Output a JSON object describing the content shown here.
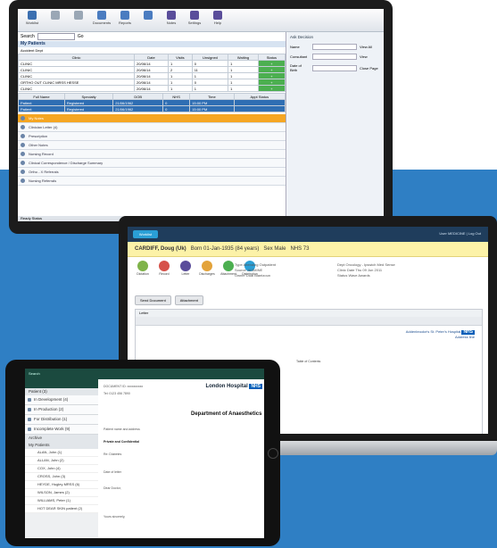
{
  "desktop": {
    "toolbar": [
      {
        "label": "Worklist",
        "color": "#3b6fb0",
        "icon": "list-icon"
      },
      {
        "label": "",
        "color": "#9aa7b5",
        "icon": "blank-icon"
      },
      {
        "label": "",
        "color": "#9aa7b5",
        "icon": "blank-icon"
      },
      {
        "label": "Documents",
        "color": "#4a7cc0",
        "icon": "document-icon"
      },
      {
        "label": "Reports",
        "color": "#4a7cc0",
        "icon": "report-icon"
      },
      {
        "label": "",
        "color": "#4a7cc0",
        "icon": "settings-icon"
      },
      {
        "label": "Notes",
        "color": "#5a4d9a",
        "icon": "notes-icon"
      },
      {
        "label": "Settings",
        "color": "#5a4d9a",
        "icon": "gear-icon"
      },
      {
        "label": "Help",
        "color": "#5a4d9a",
        "icon": "help-icon"
      }
    ],
    "search_label": "Search",
    "search_go": "Go",
    "section_title": "My Patients",
    "filter_label": "Accident Dept",
    "grid_headers": [
      "Clinic",
      "Date",
      "Visits",
      "Unsigned",
      "Waiting",
      "Status"
    ],
    "grid_rows": [
      [
        "CLINIC",
        "20/06/14",
        "1",
        "0",
        "1",
        "+"
      ],
      [
        "CLINIC",
        "20/06/14",
        "2",
        "11",
        "1",
        "+"
      ],
      [
        "CLINIC",
        "20/06/14",
        "1",
        "1",
        "1",
        "+"
      ],
      [
        "ORTHO OUT CLINIC MRSS HESSE",
        "20/06/14",
        "1",
        "0",
        "1",
        "+"
      ],
      [
        "CLINIC",
        "20/06/14",
        "1",
        "1",
        "1",
        "+"
      ]
    ],
    "sub_headers": [
      "Full Name",
      "Specialty",
      "DOB",
      "NHS",
      "Time",
      "Appt Status"
    ],
    "sub_rows": [
      [
        "Patient",
        "Registered",
        "21/06/1962",
        "0",
        "15:00 PM"
      ],
      [
        "Patient",
        "Registered",
        "21/06/1962",
        "0",
        "15:00 PM"
      ]
    ],
    "timeline": [
      {
        "label": "My Notes",
        "highlight": true
      },
      {
        "label": "Clinician Letter (4)",
        "highlight": false
      },
      {
        "label": "Prescription",
        "highlight": false
      },
      {
        "label": "Other Notes",
        "highlight": false
      },
      {
        "label": "Nursing Record",
        "highlight": false
      },
      {
        "label": "Clinical Correspondence / Discharge Summary",
        "highlight": false
      },
      {
        "label": "Ortho - X Referrals",
        "highlight": false
      },
      {
        "label": "Nursing Referrals",
        "highlight": false
      }
    ],
    "status_bar": "Ready Status",
    "right_panel": {
      "title": "Ask Decision",
      "fields": [
        "Name",
        "Consultant",
        "Date of Birth"
      ],
      "buttons": [
        "View All",
        "View",
        "Close Page"
      ]
    }
  },
  "laptop": {
    "tag": "Worklist",
    "user": "User MEDICINE  | Log Out",
    "banner_name": "CARDIFF, Doug (Uk)",
    "banner_born": "Born 01-Jan-1935 (84 years)",
    "banner_sex": "Sex Male",
    "banner_nhs": "NHS 73",
    "actions": [
      "Dictation",
      "Record",
      "Letter",
      "Discharges",
      "Attachment",
      "Distribution"
    ],
    "meta_left": [
      "Type Attending Outpatient",
      "Source JASMINE",
      "Owner Dual Blantzoun"
    ],
    "meta_right": [
      "Dept Oncology - Ipswich Med Sense",
      "Clinic Date Thu 09 Jun 2011",
      "Status Wave Awards"
    ],
    "buttons": [
      "Send Document",
      "Attachment"
    ],
    "doc_tab": "Letter",
    "doc_hosp": "Addenbrooke's St. Peter's Hospital",
    "doc_sub": "Address line",
    "doc_center": "Table of Contents",
    "nhs": "NHS"
  },
  "tablet": {
    "header": "Search",
    "sidebar": [
      {
        "label": "Patient (3)",
        "type": "section"
      },
      {
        "label": "In Development (4)",
        "type": "row"
      },
      {
        "label": "In Production (2)",
        "type": "row"
      },
      {
        "label": "For Distribution (1)",
        "type": "row"
      },
      {
        "label": "Incomplete Work (9)",
        "type": "row"
      },
      {
        "label": "Archive",
        "type": "section"
      },
      {
        "label": "My Patients",
        "type": "section"
      },
      {
        "label": "ALAN, John (1)",
        "type": "sub"
      },
      {
        "label": "ALLAN, John (2)",
        "type": "sub"
      },
      {
        "label": "COX, John (4)",
        "type": "sub"
      },
      {
        "label": "CROSS, John (3)",
        "type": "sub"
      },
      {
        "label": "HEYDE, Hugley MRSS (6)",
        "type": "sub"
      },
      {
        "label": "WILSON, James (2)",
        "type": "sub"
      },
      {
        "label": "WILLIAMS, Peter (1)",
        "type": "sub"
      },
      {
        "label": "HOT DEAR SKIN patient (2)",
        "type": "sub"
      }
    ],
    "hospital": "London Hospital",
    "department": "Department of Anaesthetics",
    "lines": [
      "DOCUMENT ID: xxxxxxxxxx",
      "Tel: 0123 456 7890",
      "Patient name and address",
      "Private and Confidential",
      "Re: Diabetes",
      "Date of letter",
      "Dear Doctor,",
      "Yours sincerely,"
    ]
  }
}
